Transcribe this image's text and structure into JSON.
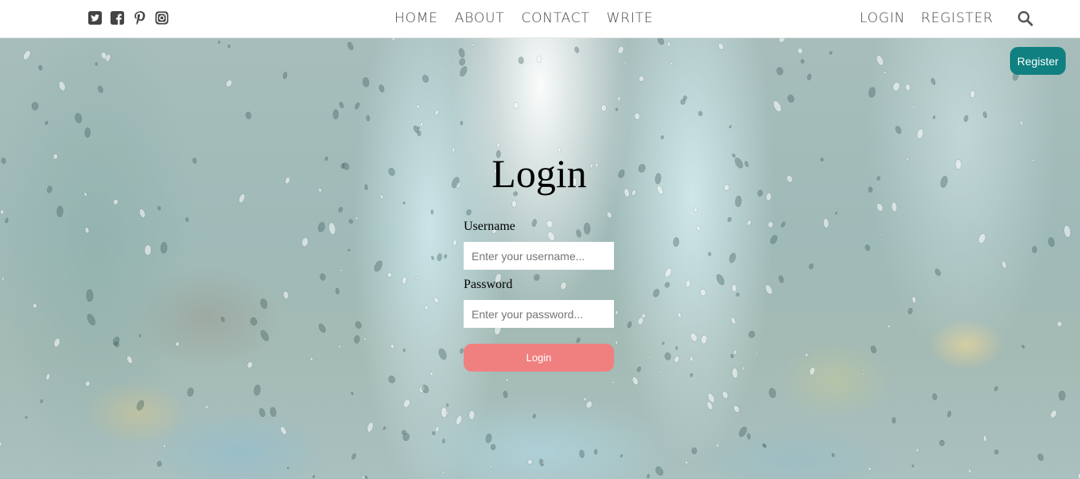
{
  "topbar": {
    "social_icons": [
      "twitter-square-icon",
      "facebook-square-icon",
      "pinterest-icon",
      "instagram-icon"
    ],
    "nav_center": [
      "HOME",
      "ABOUT",
      "CONTACT",
      "WRITE"
    ],
    "nav_right": [
      "LOGIN",
      "REGISTER"
    ],
    "search_icon": "search-icon",
    "icon_color": "#444444"
  },
  "register_button": {
    "label": "Register",
    "color": "#108080"
  },
  "login_form": {
    "title": "Login",
    "username_label": "Username",
    "username_placeholder": "Enter your username...",
    "password_label": "Password",
    "password_placeholder": "Enter your password...",
    "submit_label": "Login",
    "submit_color": "#f08080"
  }
}
